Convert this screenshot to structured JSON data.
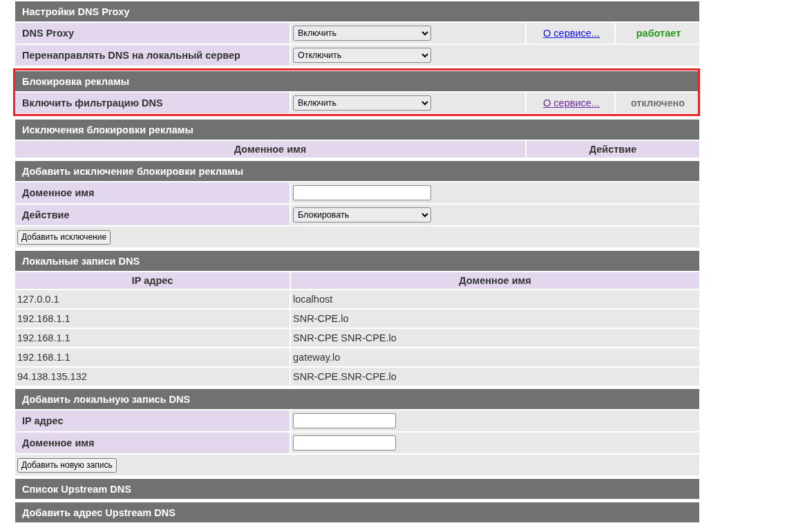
{
  "sections": [
    {
      "kind": "settings",
      "title": "Настройки DNS Proxy",
      "rows": [
        {
          "label": "DNS Proxy",
          "control": {
            "kind": "select",
            "value": "Включить"
          },
          "link": {
            "text": "О сервисе...",
            "visited": false
          },
          "status": {
            "text": "работает",
            "color": "#2a9a1e"
          }
        },
        {
          "label": "Перенаправлять DNS на локальный сервер",
          "control": {
            "kind": "select",
            "value": "Отключить"
          }
        }
      ]
    },
    {
      "kind": "settings",
      "title": "Блокировка рекламы",
      "highlighted": true,
      "rows": [
        {
          "label": "Включить фильтрацию DNS",
          "control": {
            "kind": "select",
            "value": "Включить"
          },
          "link": {
            "text": "О сервисе...",
            "visited": true
          },
          "status": {
            "text": "отключено",
            "color": "#707070"
          }
        }
      ]
    },
    {
      "kind": "wide-table",
      "title": "Исключения блокировки рекламы",
      "columns": [
        "Доменное имя",
        "Действие"
      ]
    },
    {
      "kind": "settings",
      "title": "Добавить исключение блокировки рекламы",
      "rows": [
        {
          "label": "Доменное имя",
          "control": {
            "kind": "input"
          }
        },
        {
          "label": "Действие",
          "control": {
            "kind": "select",
            "value": "Блокировать"
          }
        }
      ],
      "button": "Добавить исключение"
    },
    {
      "kind": "narrow-table",
      "title": "Локальные записи DNS",
      "columns": [
        "IP адрес",
        "Доменное имя"
      ],
      "rows": [
        [
          "127.0.0.1",
          "localhost"
        ],
        [
          "192.168.1.1",
          "SNR-CPE.lo"
        ],
        [
          "192.168.1.1",
          "SNR-CPE SNR-CPE.lo"
        ],
        [
          "192.168.1.1",
          "gateway.lo"
        ],
        [
          "94.138.135.132",
          "SNR-CPE.SNR-CPE.lo"
        ]
      ]
    },
    {
      "kind": "settings",
      "title": "Добавить локальную запись DNS",
      "rows": [
        {
          "label": "IP адрес",
          "control": {
            "kind": "short-input"
          }
        },
        {
          "label": "Доменное имя",
          "control": {
            "kind": "short-input"
          }
        }
      ],
      "button": "Добавить новую запись"
    },
    {
      "kind": "header",
      "title": "Список Upstream DNS"
    },
    {
      "kind": "header",
      "title": "Добавить адрес Upstream DNS"
    }
  ]
}
